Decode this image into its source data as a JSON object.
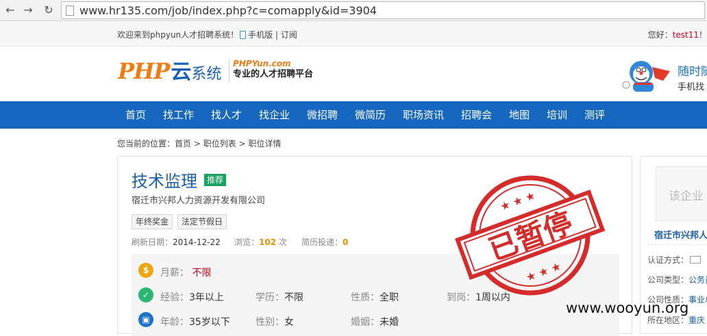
{
  "browser": {
    "url": "www.hr135.com/job/index.php?c=comapply&id=3904",
    "back_icon": "back-arrow-icon",
    "forward_icon": "forward-arrow-icon",
    "reload_icon": "reload-icon"
  },
  "topbar": {
    "welcome": "欢迎来到phpyun人才招聘系统！",
    "mobile_link": "手机版",
    "separator": "|",
    "subscribe_link": "订阅",
    "greeting": "您好：",
    "username": "test11",
    "greeting_end": "！"
  },
  "header": {
    "logo_php": "PHP",
    "logo_yun": "云",
    "logo_system": "系统",
    "logo_site": "PHPYun.com",
    "logo_slogan": "专业的人才招聘平台",
    "right_title": "随时随",
    "right_sub": "手机找"
  },
  "nav": {
    "items": [
      "首页",
      "找工作",
      "找人才",
      "找企业",
      "微招聘",
      "微简历",
      "职场资讯",
      "招聘会",
      "地图",
      "培训",
      "测评"
    ]
  },
  "breadcrumb": {
    "prefix": "您当前的位置：",
    "home": "首页",
    "sep1": " > ",
    "list": "职位列表",
    "sep2": " > ",
    "current": "职位详情"
  },
  "job": {
    "title": "技术监理",
    "badge": "推荐",
    "company": "宿迁市兴邦人力资源开发有限公司",
    "tags": [
      "年终奖金",
      "法定节假日"
    ],
    "refresh_label": "刷新日期：",
    "refresh_date": "2014-12-22",
    "views_label": "浏览：",
    "views": "102",
    "views_unit": " 次",
    "applications_label": "简历投递：",
    "applications": "0",
    "stamp_text": "已暂停",
    "salary_label": "月薪：",
    "salary": "不限",
    "experience_label": "经验：",
    "experience": "3年以上",
    "education_label": "学历：",
    "education": "不限",
    "nature_label": "性质：",
    "nature": "全职",
    "arrival_label": "到岗：",
    "arrival": "1周以内",
    "age_label": "年龄：",
    "age": "35岁以下",
    "gender_label": "性别：",
    "gender": "女",
    "marriage_label": "婚姻：",
    "marriage": "未婚"
  },
  "sidebar": {
    "logo_placeholder": "该企业",
    "company_name": "宿迁市兴邦人",
    "cert_label": "认证方式：",
    "type_label": "公司类型：",
    "type_value": "公务员",
    "nature_label": "公司性质：",
    "nature_value": "事业单",
    "region_label": "所在地区：",
    "region_value": "重庆"
  },
  "watermark": "www.wooyun.org",
  "colors": {
    "nav_bg": "#1667bd",
    "badge": "#19a15f",
    "stamp": "#d62b2b",
    "highlight": "#e88f00"
  }
}
